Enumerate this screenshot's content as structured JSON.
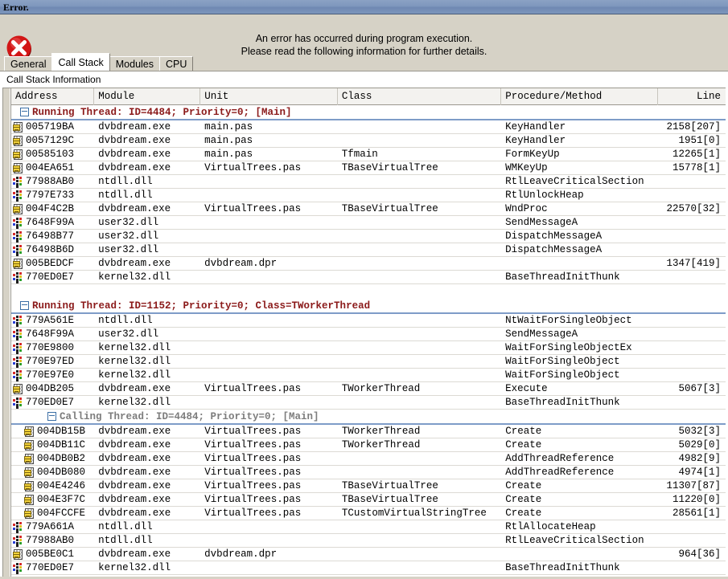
{
  "window": {
    "title": "Error."
  },
  "banner": {
    "icon": "error-circle-x-icon",
    "line1": "An error has occurred during program execution.",
    "line2": "Please read the following information for further details."
  },
  "tabs": [
    {
      "label": "General",
      "active": false
    },
    {
      "label": "Call Stack",
      "active": true
    },
    {
      "label": "Modules",
      "active": false
    },
    {
      "label": "CPU",
      "active": false
    }
  ],
  "panel": {
    "caption": "Call Stack Information"
  },
  "columns": [
    {
      "key": "address",
      "label": "Address"
    },
    {
      "key": "module",
      "label": "Module"
    },
    {
      "key": "unit",
      "label": "Unit"
    },
    {
      "key": "class",
      "label": "Class"
    },
    {
      "key": "procedure",
      "label": "Procedure/Method"
    },
    {
      "key": "line",
      "label": "Line"
    }
  ],
  "colors": {
    "titlebar": "#7e97bd",
    "dialog_face": "#d6d2c6",
    "group_header_text": "#8b1a1a",
    "nested_group_header_text": "#7d7d7d",
    "group_underline": "#7e9cc8",
    "error_icon": "#cc0000"
  },
  "rows": [
    {
      "type": "group",
      "expander": "minus",
      "text": "Running Thread: ID=4484; Priority=0; [Main]",
      "nested": false
    },
    {
      "type": "row",
      "icon": "module-icon",
      "address": "005719BA",
      "module": "dvbdream.exe",
      "unit": "main.pas",
      "class": "",
      "procedure": "KeyHandler",
      "line": "2158[207]",
      "indent": false
    },
    {
      "type": "row",
      "icon": "module-icon",
      "address": "0057129C",
      "module": "dvbdream.exe",
      "unit": "main.pas",
      "class": "",
      "procedure": "KeyHandler",
      "line": "1951[0]",
      "indent": false
    },
    {
      "type": "row",
      "icon": "module-icon",
      "address": "00585103",
      "module": "dvbdream.exe",
      "unit": "main.pas",
      "class": "Tfmain",
      "procedure": "FormKeyUp",
      "line": "12265[1]",
      "indent": false
    },
    {
      "type": "row",
      "icon": "module-icon",
      "address": "004EA651",
      "module": "dvbdream.exe",
      "unit": "VirtualTrees.pas",
      "class": "TBaseVirtualTree",
      "procedure": "WMKeyUp",
      "line": "15778[1]",
      "indent": false
    },
    {
      "type": "row",
      "icon": "system-dll-icon",
      "address": "77988AB0",
      "module": "ntdll.dll",
      "unit": "",
      "class": "",
      "procedure": "RtlLeaveCriticalSection",
      "line": "",
      "indent": false
    },
    {
      "type": "row",
      "icon": "system-dll-icon",
      "address": "7797E733",
      "module": "ntdll.dll",
      "unit": "",
      "class": "",
      "procedure": "RtlUnlockHeap",
      "line": "",
      "indent": false
    },
    {
      "type": "row",
      "icon": "module-icon",
      "address": "004F4C2B",
      "module": "dvbdream.exe",
      "unit": "VirtualTrees.pas",
      "class": "TBaseVirtualTree",
      "procedure": "WndProc",
      "line": "22570[32]",
      "indent": false
    },
    {
      "type": "row",
      "icon": "system-dll-icon",
      "address": "7648F99A",
      "module": "user32.dll",
      "unit": "",
      "class": "",
      "procedure": "SendMessageA",
      "line": "",
      "indent": false
    },
    {
      "type": "row",
      "icon": "system-dll-icon",
      "address": "76498B77",
      "module": "user32.dll",
      "unit": "",
      "class": "",
      "procedure": "DispatchMessageA",
      "line": "",
      "indent": false
    },
    {
      "type": "row",
      "icon": "system-dll-icon",
      "address": "76498B6D",
      "module": "user32.dll",
      "unit": "",
      "class": "",
      "procedure": "DispatchMessageA",
      "line": "",
      "indent": false
    },
    {
      "type": "row",
      "icon": "module-icon",
      "address": "005BEDCF",
      "module": "dvbdream.exe",
      "unit": "dvbdream.dpr",
      "class": "",
      "procedure": "",
      "line": "1347[419]",
      "indent": false
    },
    {
      "type": "row",
      "icon": "system-dll-icon",
      "address": "770ED0E7",
      "module": "kernel32.dll",
      "unit": "",
      "class": "",
      "procedure": "BaseThreadInitThunk",
      "line": "",
      "indent": false
    },
    {
      "type": "spacer"
    },
    {
      "type": "group",
      "expander": "minus",
      "text": "Running Thread: ID=1152; Priority=0; Class=TWorkerThread",
      "nested": false
    },
    {
      "type": "row",
      "icon": "system-dll-icon",
      "address": "779A561E",
      "module": "ntdll.dll",
      "unit": "",
      "class": "",
      "procedure": "NtWaitForSingleObject",
      "line": "",
      "indent": false
    },
    {
      "type": "row",
      "icon": "system-dll-icon",
      "address": "7648F99A",
      "module": "user32.dll",
      "unit": "",
      "class": "",
      "procedure": "SendMessageA",
      "line": "",
      "indent": false
    },
    {
      "type": "row",
      "icon": "system-dll-icon",
      "address": "770E9800",
      "module": "kernel32.dll",
      "unit": "",
      "class": "",
      "procedure": "WaitForSingleObjectEx",
      "line": "",
      "indent": false
    },
    {
      "type": "row",
      "icon": "system-dll-icon",
      "address": "770E97ED",
      "module": "kernel32.dll",
      "unit": "",
      "class": "",
      "procedure": "WaitForSingleObject",
      "line": "",
      "indent": false
    },
    {
      "type": "row",
      "icon": "system-dll-icon",
      "address": "770E97E0",
      "module": "kernel32.dll",
      "unit": "",
      "class": "",
      "procedure": "WaitForSingleObject",
      "line": "",
      "indent": false
    },
    {
      "type": "row",
      "icon": "module-icon",
      "address": "004DB205",
      "module": "dvbdream.exe",
      "unit": "VirtualTrees.pas",
      "class": "TWorkerThread",
      "procedure": "Execute",
      "line": "5067[3]",
      "indent": false
    },
    {
      "type": "row",
      "icon": "system-dll-icon",
      "address": "770ED0E7",
      "module": "kernel32.dll",
      "unit": "",
      "class": "",
      "procedure": "BaseThreadInitThunk",
      "line": "",
      "indent": false
    },
    {
      "type": "group",
      "expander": "minus",
      "text": "Calling Thread: ID=4484; Priority=0; [Main]",
      "nested": true
    },
    {
      "type": "row",
      "icon": "module-icon",
      "address": "004DB15B",
      "module": "dvbdream.exe",
      "unit": "VirtualTrees.pas",
      "class": "TWorkerThread",
      "procedure": "Create",
      "line": "5032[3]",
      "indent": true
    },
    {
      "type": "row",
      "icon": "module-icon",
      "address": "004DB11C",
      "module": "dvbdream.exe",
      "unit": "VirtualTrees.pas",
      "class": "TWorkerThread",
      "procedure": "Create",
      "line": "5029[0]",
      "indent": true
    },
    {
      "type": "row",
      "icon": "module-icon",
      "address": "004DB0B2",
      "module": "dvbdream.exe",
      "unit": "VirtualTrees.pas",
      "class": "",
      "procedure": "AddThreadReference",
      "line": "4982[9]",
      "indent": true
    },
    {
      "type": "row",
      "icon": "module-icon",
      "address": "004DB080",
      "module": "dvbdream.exe",
      "unit": "VirtualTrees.pas",
      "class": "",
      "procedure": "AddThreadReference",
      "line": "4974[1]",
      "indent": true
    },
    {
      "type": "row",
      "icon": "module-icon",
      "address": "004E4246",
      "module": "dvbdream.exe",
      "unit": "VirtualTrees.pas",
      "class": "TBaseVirtualTree",
      "procedure": "Create",
      "line": "11307[87]",
      "indent": true
    },
    {
      "type": "row",
      "icon": "module-icon",
      "address": "004E3F7C",
      "module": "dvbdream.exe",
      "unit": "VirtualTrees.pas",
      "class": "TBaseVirtualTree",
      "procedure": "Create",
      "line": "11220[0]",
      "indent": true
    },
    {
      "type": "row",
      "icon": "module-icon",
      "address": "004FCCFE",
      "module": "dvbdream.exe",
      "unit": "VirtualTrees.pas",
      "class": "TCustomVirtualStringTree",
      "procedure": "Create",
      "line": "28561[1]",
      "indent": true
    },
    {
      "type": "row",
      "icon": "system-dll-icon",
      "address": "779A661A",
      "module": "ntdll.dll",
      "unit": "",
      "class": "",
      "procedure": "RtlAllocateHeap",
      "line": "",
      "indent": false
    },
    {
      "type": "row",
      "icon": "system-dll-icon",
      "address": "77988AB0",
      "module": "ntdll.dll",
      "unit": "",
      "class": "",
      "procedure": "RtlLeaveCriticalSection",
      "line": "",
      "indent": false
    },
    {
      "type": "row",
      "icon": "module-icon",
      "address": "005BE0C1",
      "module": "dvbdream.exe",
      "unit": "dvbdream.dpr",
      "class": "",
      "procedure": "",
      "line": "964[36]",
      "indent": false
    },
    {
      "type": "row",
      "icon": "system-dll-icon",
      "address": "770ED0E7",
      "module": "kernel32.dll",
      "unit": "",
      "class": "",
      "procedure": "BaseThreadInitThunk",
      "line": "",
      "indent": false
    }
  ]
}
